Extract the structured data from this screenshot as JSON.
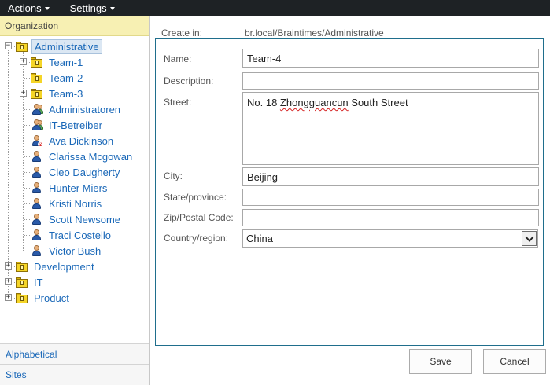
{
  "menubar": {
    "items": [
      {
        "label": "Actions"
      },
      {
        "label": "Settings"
      }
    ]
  },
  "left": {
    "header": "Organization",
    "tree": [
      {
        "label": "Administrative",
        "icon": "folder-icon",
        "level": 0,
        "expander": "−",
        "selected": true
      },
      {
        "label": "Team-1",
        "icon": "folder-icon",
        "level": 1,
        "expander": "+"
      },
      {
        "label": "Team-2",
        "icon": "folder-icon",
        "level": 1,
        "expander": ""
      },
      {
        "label": "Team-3",
        "icon": "folder-icon",
        "level": 1,
        "expander": "+"
      },
      {
        "label": "Administratoren",
        "icon": "user-group-icon",
        "level": 1
      },
      {
        "label": "IT-Betreiber",
        "icon": "user-group-icon",
        "level": 1
      },
      {
        "label": "Ava Dickinson",
        "icon": "user-disabled-icon",
        "level": 1
      },
      {
        "label": "Clarissa Mcgowan",
        "icon": "user-icon",
        "level": 1
      },
      {
        "label": "Cleo Daugherty",
        "icon": "user-icon",
        "level": 1
      },
      {
        "label": "Hunter Miers",
        "icon": "user-icon",
        "level": 1
      },
      {
        "label": "Kristi Norris",
        "icon": "user-icon",
        "level": 1
      },
      {
        "label": "Scott Newsome",
        "icon": "user-icon",
        "level": 1
      },
      {
        "label": "Traci Costello",
        "icon": "user-icon",
        "level": 1
      },
      {
        "label": "Victor Bush",
        "icon": "user-icon",
        "level": 1
      },
      {
        "label": "Development",
        "icon": "folder-icon",
        "level": 0,
        "expander": "+"
      },
      {
        "label": "IT",
        "icon": "folder-icon",
        "level": 0,
        "expander": "+"
      },
      {
        "label": "Product",
        "icon": "folder-icon",
        "level": 0,
        "expander": "+"
      }
    ],
    "nav": [
      {
        "label": "Alphabetical"
      },
      {
        "label": "Sites"
      }
    ]
  },
  "form": {
    "create_in_label": "Create in:",
    "create_in_value": "br.local/Braintimes/Administrative",
    "name_label": "Name:",
    "name_value": "Team-4",
    "description_label": "Description:",
    "description_value": "",
    "street_label": "Street:",
    "street_value_prefix": "No. 18 ",
    "street_value_misspelled": "Zhongguancun",
    "street_value_suffix": " South Street",
    "city_label": "City:",
    "city_value": "Beijing",
    "state_label": "State/province:",
    "state_value": "",
    "zip_label": "Zip/Postal Code:",
    "zip_value": "",
    "country_label": "Country/region:",
    "country_value": "China"
  },
  "buttons": {
    "save": "Save",
    "cancel": "Cancel"
  }
}
